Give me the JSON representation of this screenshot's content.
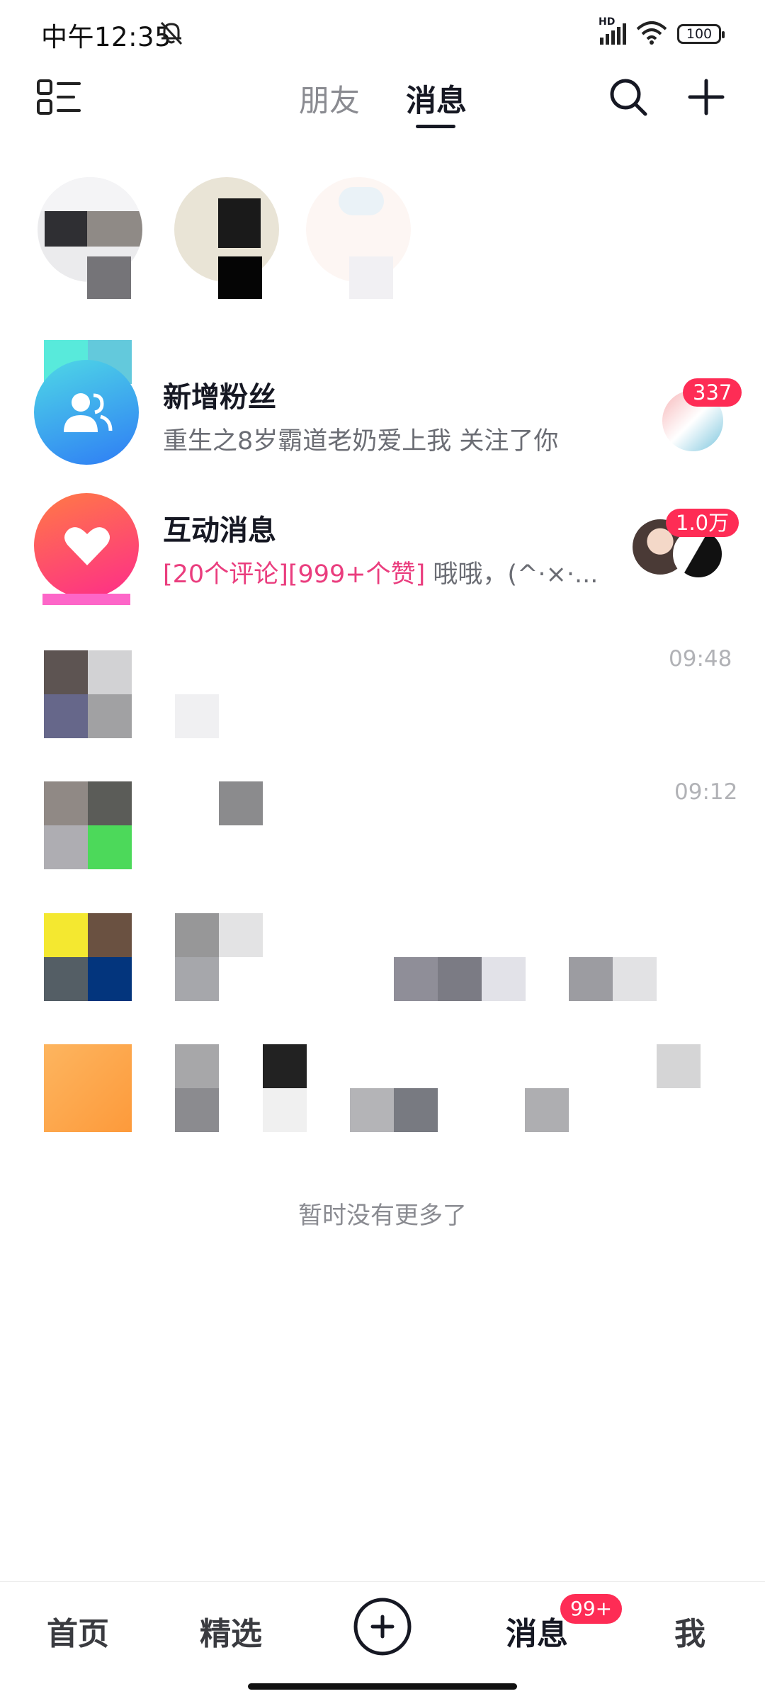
{
  "status_bar": {
    "time": "中午12:35",
    "network": "HD",
    "battery": "100"
  },
  "header": {
    "tabs": [
      {
        "label": "朋友",
        "active": false
      },
      {
        "label": "消息",
        "active": true
      }
    ],
    "icons": [
      "menu-icon",
      "search-icon",
      "plus-icon"
    ]
  },
  "stories": [
    {
      "avatar_colors": [
        "#e6e6e8",
        "#8f8a86",
        "#757478"
      ]
    },
    {
      "avatar_colors": [
        "#e9e4d6",
        "#111111",
        "#050505"
      ]
    },
    {
      "avatar_colors": [
        "#fdf3f1",
        "#fff7f2",
        "#f1f0f3"
      ]
    }
  ],
  "system_items": [
    {
      "title": "新增粉丝",
      "subtitle": "重生之8岁霸道老奶爱上我 关注了你",
      "badge": "337",
      "icon": "followers-icon",
      "gradient": [
        "#4fd8e6",
        "#2e7cf5"
      ]
    },
    {
      "title": "互动消息",
      "subtitle_highlight": "[20个评论][999+个赞]",
      "subtitle_rest": " 哦哦，(^·×·...",
      "badge": "1.0万",
      "icon": "heart-icon",
      "gradient": [
        "#ff7a45",
        "#fe2c8a"
      ]
    }
  ],
  "conversations": [
    {
      "time": "09:48"
    },
    {
      "time": "09:12"
    },
    {
      "time": ""
    },
    {
      "time": ""
    }
  ],
  "footer_note": "暂时没有更多了",
  "bottom_nav": {
    "items": [
      "首页",
      "精选",
      "消息",
      "我"
    ],
    "publish_icon": "plus-circle-icon",
    "messages_badge": "99+"
  },
  "colors": {
    "accent": "#fe2c55",
    "text_primary": "#161823",
    "text_secondary": "#8a8b91"
  }
}
